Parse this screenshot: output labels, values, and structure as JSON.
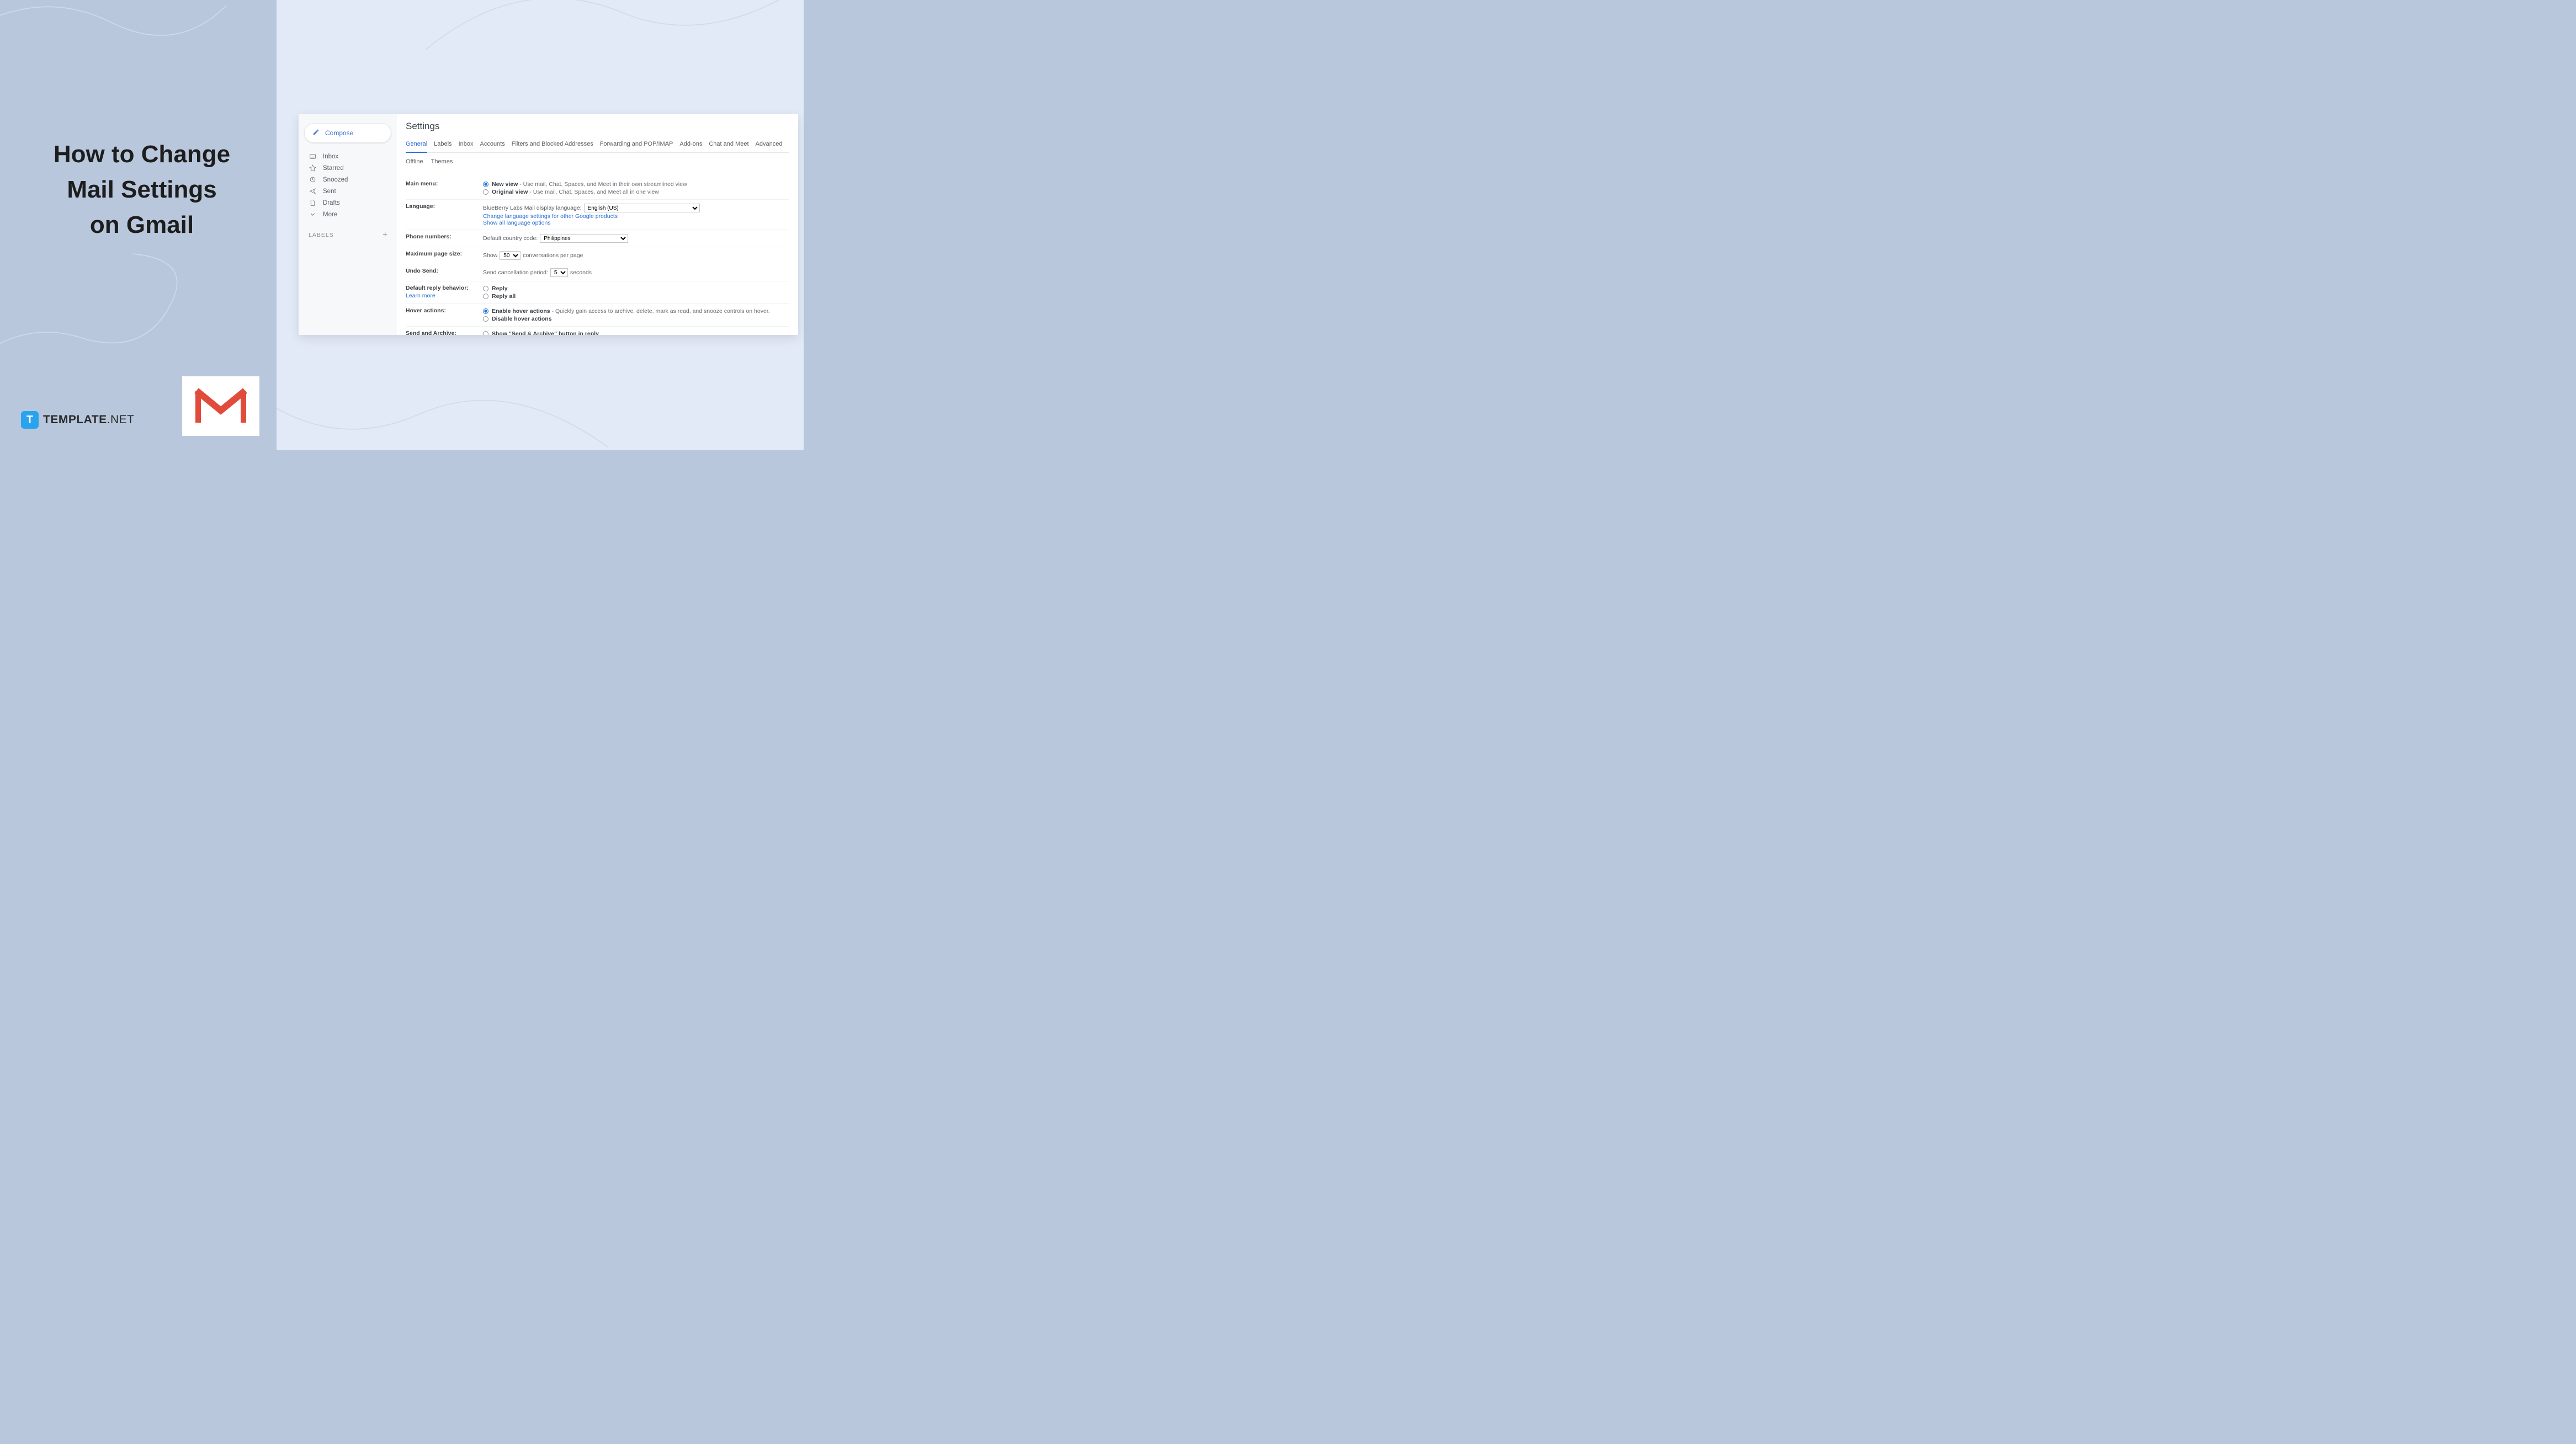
{
  "hero": {
    "line1": "How to Change",
    "line2": "Mail Settings",
    "line3": "on Gmail"
  },
  "brand": {
    "icon_letter": "T",
    "name_bold": "TEMPLATE",
    "name_light": ".NET"
  },
  "gmail_logo": {
    "label": "Gmail logo"
  },
  "sidebar": {
    "compose_label": "Compose",
    "items": [
      {
        "icon": "inbox",
        "label": "Inbox"
      },
      {
        "icon": "star",
        "label": "Starred"
      },
      {
        "icon": "clock",
        "label": "Snoozed"
      },
      {
        "icon": "send",
        "label": "Sent"
      },
      {
        "icon": "file",
        "label": "Drafts"
      },
      {
        "icon": "chevron",
        "label": "More"
      }
    ],
    "labels_heading": "LABELS"
  },
  "settings": {
    "title": "Settings",
    "tabs_row1": [
      "General",
      "Labels",
      "Inbox",
      "Accounts",
      "Filters and Blocked Addresses",
      "Forwarding and POP/IMAP",
      "Add-ons",
      "Chat and Meet",
      "Advanced"
    ],
    "tabs_row2": [
      "Offline",
      "Themes"
    ],
    "active_tab": "General",
    "rows": {
      "main_menu": {
        "label": "Main menu:",
        "opt1_bold": "New view",
        "opt1_desc": " - Use mail, Chat, Spaces, and Meet in their own streamlined view",
        "opt2_bold": "Original view",
        "opt2_desc": " - Use mail, Chat, Spaces, and Meet all in one view",
        "selected": 0
      },
      "language": {
        "label": "Language:",
        "prefix": "BlueBerry Labs Mail display language:",
        "value": "English (US)",
        "link1": "Change language settings for other Google products",
        "link2": "Show all language options"
      },
      "phone": {
        "label": "Phone numbers:",
        "prefix": "Default country code:",
        "value": "Philippines"
      },
      "page_size": {
        "label": "Maximum page size:",
        "prefix": "Show",
        "value": "50",
        "suffix": "conversations per page"
      },
      "undo": {
        "label": "Undo Send:",
        "prefix": "Send cancellation period:",
        "value": "5",
        "suffix": "seconds"
      },
      "reply": {
        "label": "Default reply behavior:",
        "learn": "Learn more",
        "opt1": "Reply",
        "opt2": "Reply all"
      },
      "hover": {
        "label": "Hover actions:",
        "opt1_bold": "Enable hover actions",
        "opt1_desc": " - Quickly gain access to archive, delete, mark as read, and snooze controls on hover.",
        "opt2_bold": "Disable hover actions",
        "selected": 0
      },
      "send_archive": {
        "label": "Send and Archive:",
        "opt1": "Show \"Send & Archive\" button in reply"
      }
    }
  }
}
